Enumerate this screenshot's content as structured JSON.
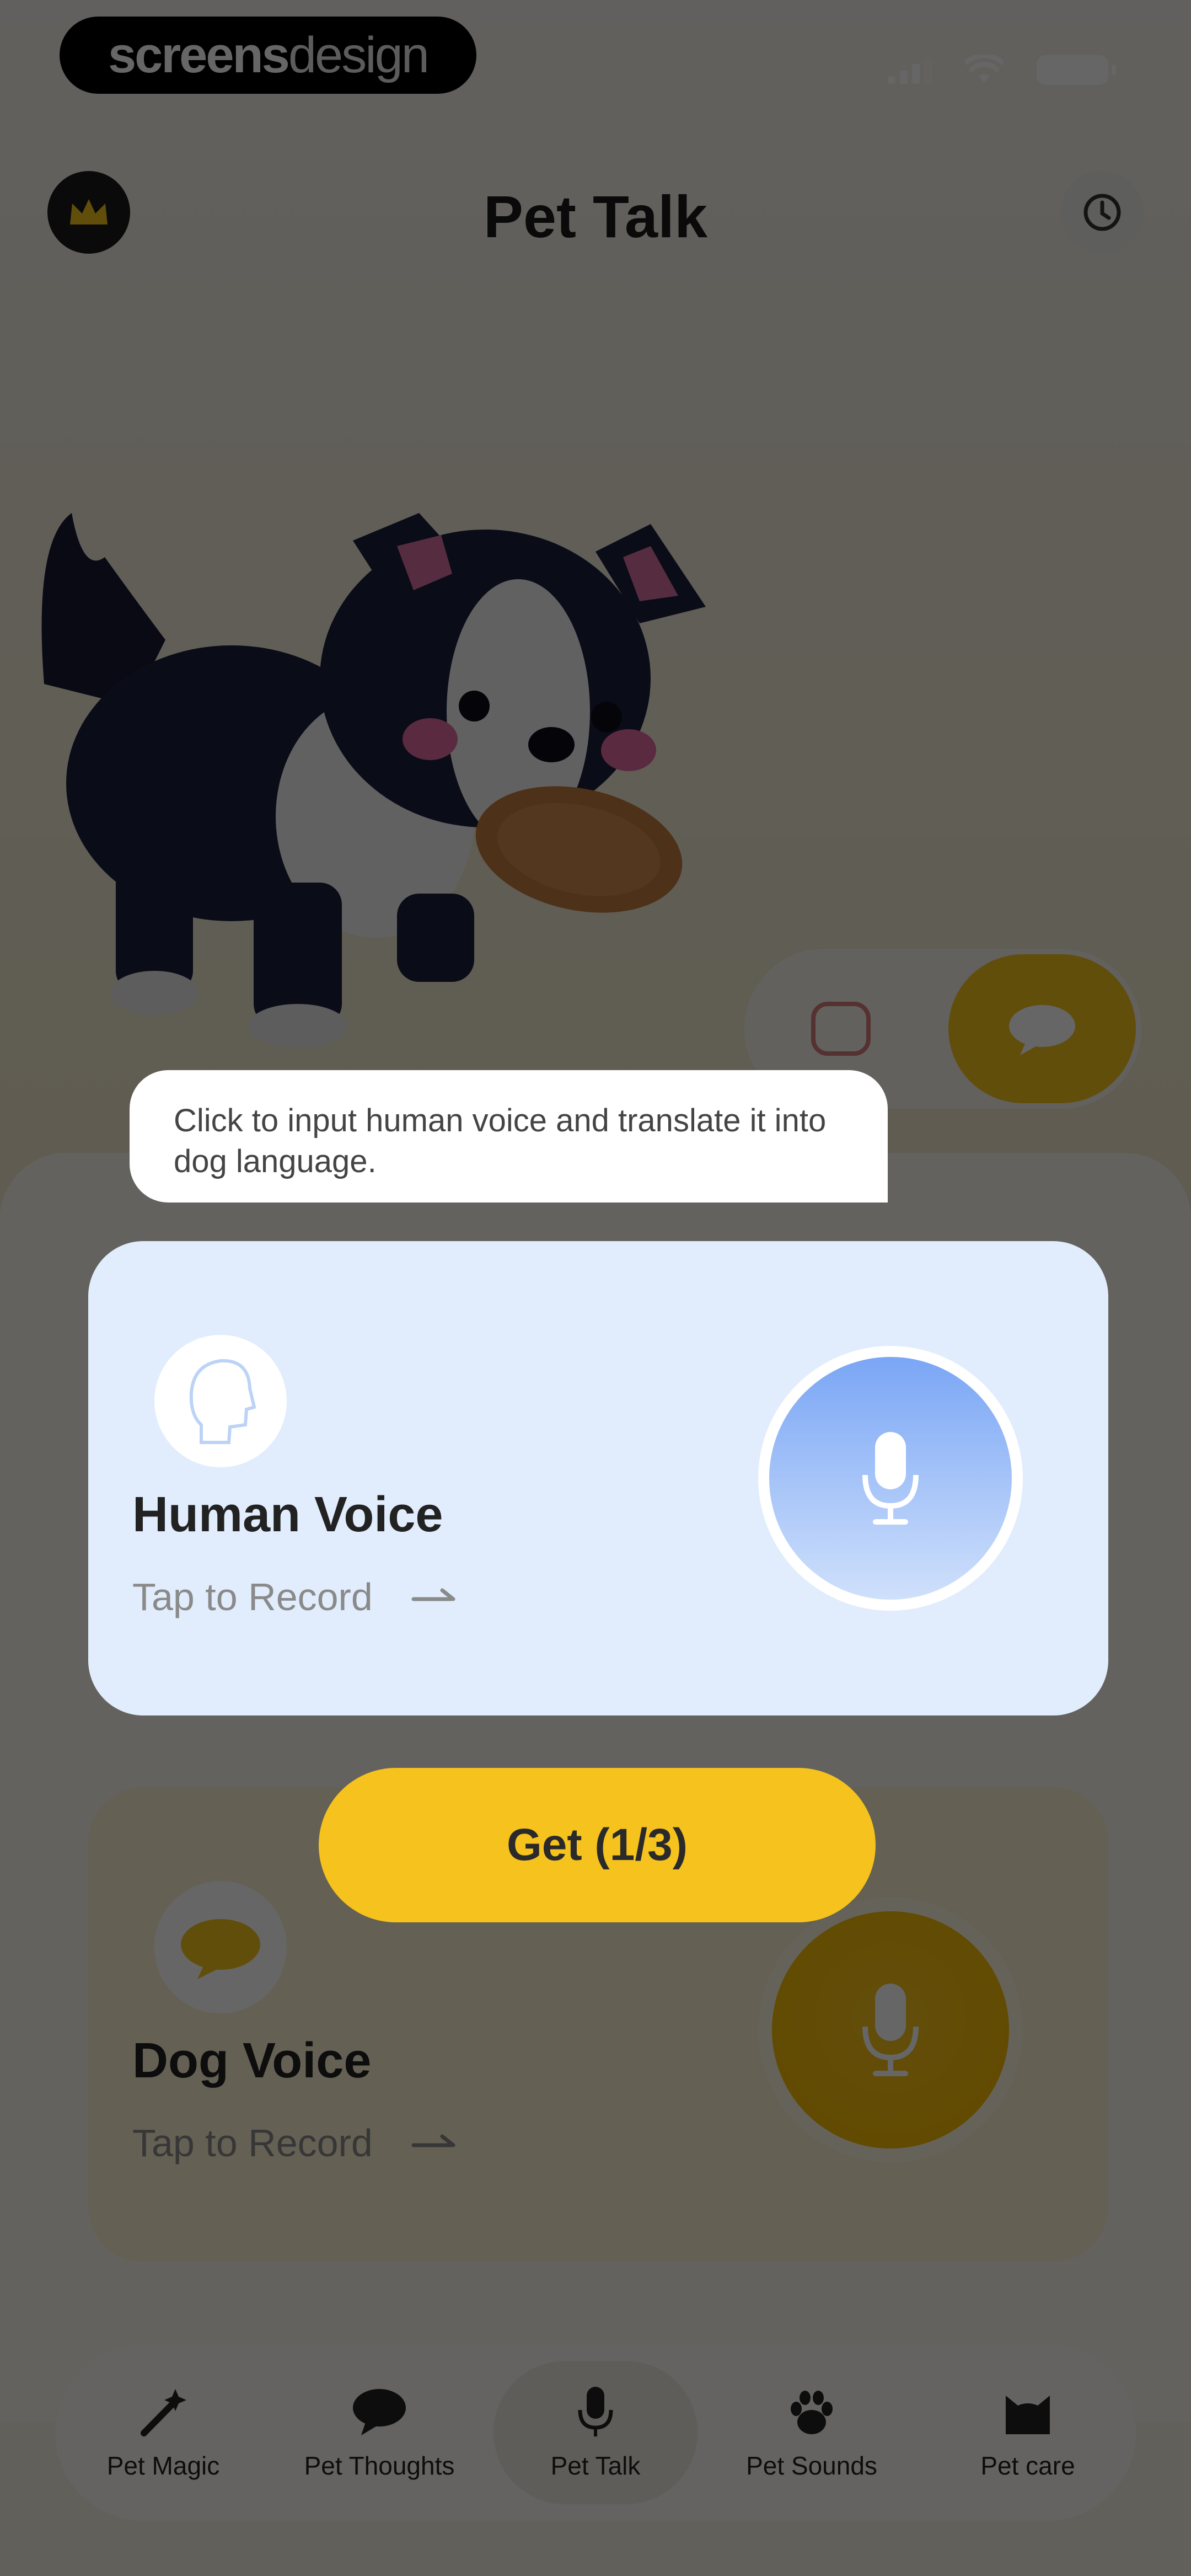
{
  "status_bar": {
    "brand_bold": "screens",
    "brand_light": "design"
  },
  "header": {
    "title": "Pet Talk",
    "premium_icon": "crown-icon",
    "history_icon": "clock-history-icon"
  },
  "tooltip": {
    "text": "Click to input human voice and translate it into dog language."
  },
  "human_card": {
    "title": "Human Voice",
    "subtitle": "Tap to Record",
    "icon": "human-head-icon",
    "mic_icon": "microphone-icon"
  },
  "dog_card": {
    "title": "Dog Voice",
    "subtitle": "Tap to Record",
    "icon": "dog-bubble-icon",
    "mic_icon": "microphone-icon"
  },
  "get_button": {
    "label": "Get (1/3)"
  },
  "tabs": [
    {
      "label": "Pet Magic",
      "icon": "magic-wand-icon"
    },
    {
      "label": "Pet Thoughts",
      "icon": "speech-bubble-icon"
    },
    {
      "label": "Pet Talk",
      "icon": "microphone-icon"
    },
    {
      "label": "Pet Sounds",
      "icon": "paw-icon"
    },
    {
      "label": "Pet care",
      "icon": "cat-face-icon"
    }
  ],
  "colors": {
    "accent_yellow": "#f6c21d",
    "human_card_bg": "#e1edfc",
    "mic_blue": "#7aa6f5"
  }
}
